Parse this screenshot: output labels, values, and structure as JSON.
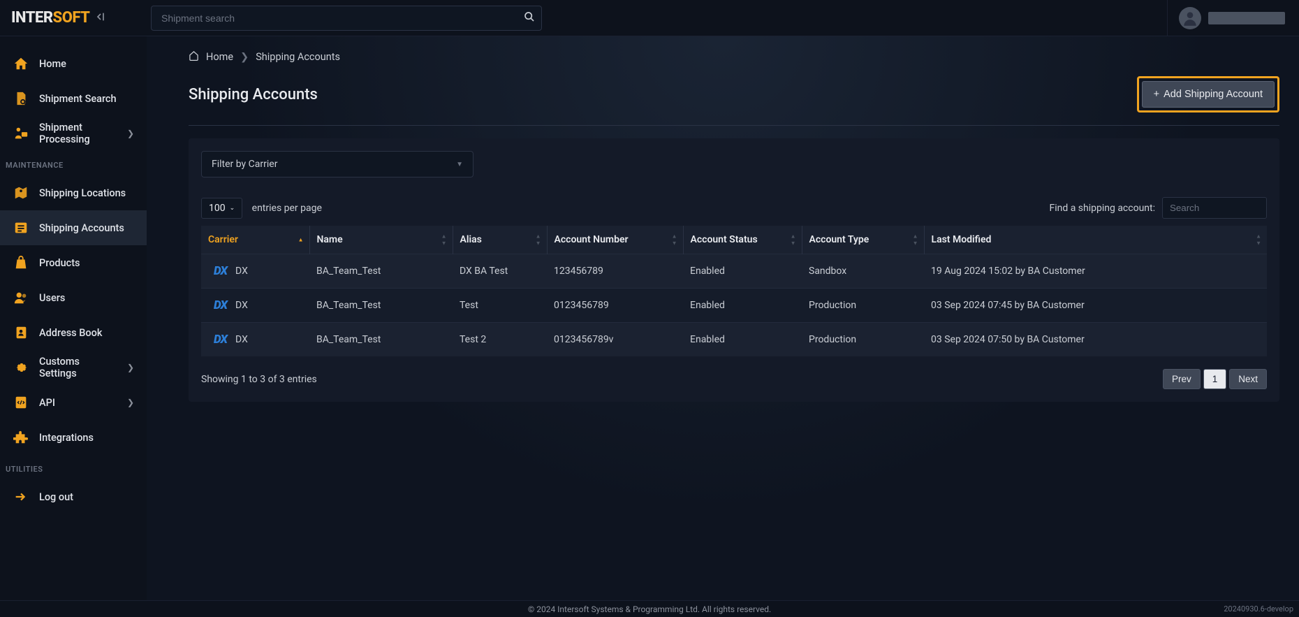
{
  "brand": {
    "inter": "INTER",
    "soft": "SOFT"
  },
  "search": {
    "placeholder": "Shipment search"
  },
  "breadcrumb": {
    "home": "Home",
    "current": "Shipping Accounts"
  },
  "page": {
    "title": "Shipping Accounts",
    "add_button": "Add Shipping Account"
  },
  "sidebar": {
    "items": [
      {
        "label": "Home"
      },
      {
        "label": "Shipment Search"
      },
      {
        "label": "Shipment Processing"
      }
    ],
    "section1": "MAINTENANCE",
    "maintenance": [
      {
        "label": "Shipping Locations"
      },
      {
        "label": "Shipping Accounts"
      },
      {
        "label": "Products"
      },
      {
        "label": "Users"
      },
      {
        "label": "Address Book"
      },
      {
        "label": "Customs Settings"
      },
      {
        "label": "API"
      },
      {
        "label": "Integrations"
      }
    ],
    "section2": "UTILITIES",
    "utilities": [
      {
        "label": "Log out"
      }
    ]
  },
  "filter": {
    "placeholder": "Filter by Carrier"
  },
  "entries": {
    "value": "100",
    "label": "entries per page"
  },
  "find": {
    "label": "Find a shipping account:",
    "placeholder": "Search"
  },
  "columns": {
    "carrier": "Carrier",
    "name": "Name",
    "alias": "Alias",
    "account_number": "Account Number",
    "account_status": "Account Status",
    "account_type": "Account Type",
    "last_modified": "Last Modified"
  },
  "rows": [
    {
      "carrier": "DX",
      "name": "BA_Team_Test",
      "alias": "DX BA Test",
      "account_number": "123456789",
      "status": "Enabled",
      "type": "Sandbox",
      "modified": "19 Aug 2024 15:02 by BA Customer"
    },
    {
      "carrier": "DX",
      "name": "BA_Team_Test",
      "alias": "Test",
      "account_number": "0123456789",
      "status": "Enabled",
      "type": "Production",
      "modified": "03 Sep 2024 07:45 by BA Customer"
    },
    {
      "carrier": "DX",
      "name": "BA_Team_Test",
      "alias": "Test 2",
      "account_number": "0123456789v",
      "status": "Enabled",
      "type": "Production",
      "modified": "03 Sep 2024 07:50 by BA Customer"
    }
  ],
  "summary": "Showing 1 to 3 of 3 entries",
  "pagination": {
    "prev": "Prev",
    "page": "1",
    "next": "Next"
  },
  "footer": {
    "copyright": "© 2024 Intersoft Systems & Programming Ltd. All rights reserved.",
    "version": "20240930.6-develop"
  }
}
